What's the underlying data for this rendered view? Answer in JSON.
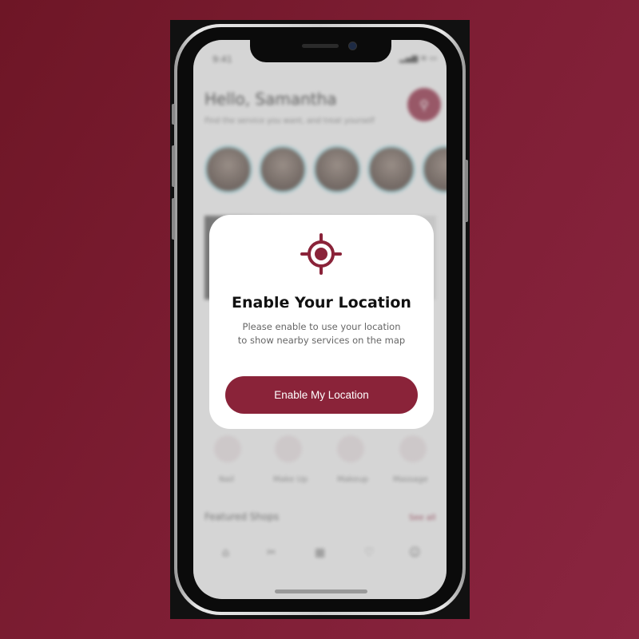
{
  "status_bar": {
    "time": "9:41"
  },
  "home": {
    "greeting": "Hello, Samantha",
    "subtitle": "Find the service you want, and treat yourself",
    "categories": [
      "Nail",
      "Make Up",
      "Makeup",
      "Massage"
    ],
    "featured_title": "Featured Shops",
    "see_all": "See all"
  },
  "modal": {
    "title": "Enable Your Location",
    "description_line1": "Please enable to use your location",
    "description_line2": "to show nearby services on the map",
    "button_label": "Enable My Location",
    "accent_color": "#8a2339"
  },
  "icons": [
    "target-location-icon",
    "search-icon",
    "home-icon",
    "explore-icon",
    "calendar-icon",
    "heart-icon",
    "profile-icon"
  ]
}
